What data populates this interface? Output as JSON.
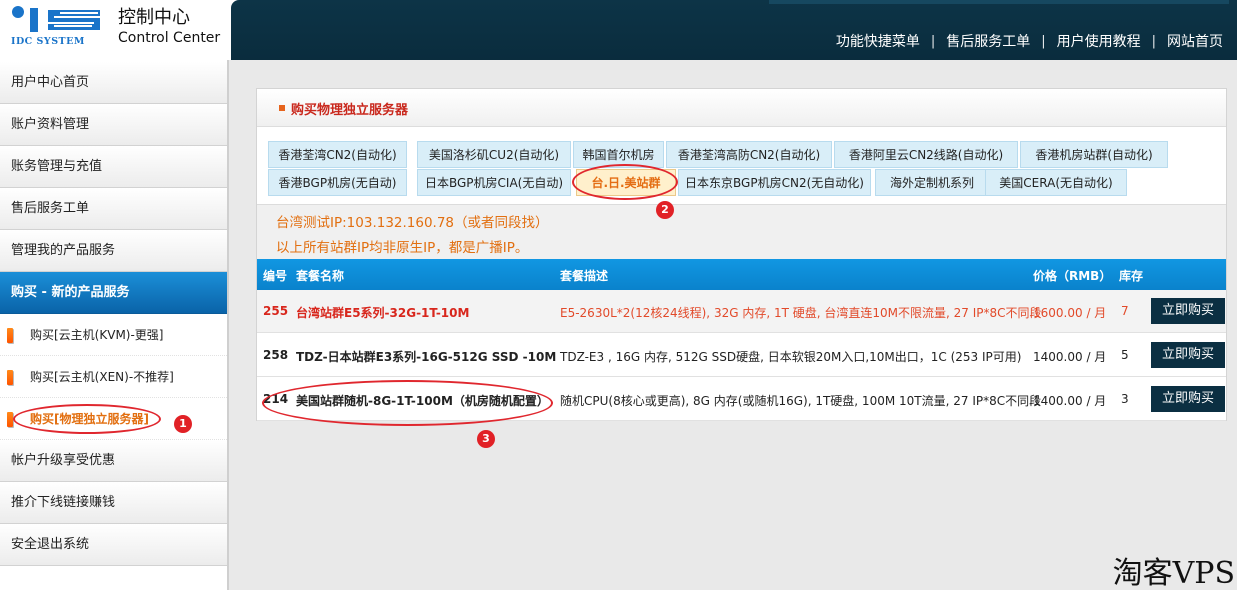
{
  "brand": {
    "logo_text": "IDC SYSTEM",
    "title_cn": "控制中心",
    "title_en": "Control Center",
    "colors": {
      "logo_blue": "#1a74c9",
      "topbar": "#0d3447"
    }
  },
  "topnav": [
    {
      "label": "功能快捷菜单"
    },
    {
      "label": "售后服务工单"
    },
    {
      "label": "用户使用教程"
    },
    {
      "label": "网站首页"
    }
  ],
  "topnav_separator": "|",
  "sidebar": {
    "items": [
      {
        "label": "用户中心首页"
      },
      {
        "label": "账户资料管理"
      },
      {
        "label": "账务管理与充值"
      },
      {
        "label": "售后服务工单"
      },
      {
        "label": "管理我的产品服务"
      },
      {
        "label": "购买 - 新的产品服务"
      },
      {
        "label": "购买[云主机(KVM)-更强]"
      },
      {
        "label": "购买[云主机(XEN)-不推荐]"
      },
      {
        "label": "购买[物理独立服务器]"
      },
      {
        "label": "帐户升级享受优惠"
      },
      {
        "label": "推介下线链接赚钱"
      },
      {
        "label": "安全退出系统"
      }
    ]
  },
  "panel": {
    "title": "购买物理独立服务器",
    "tabs": [
      {
        "label": "香港荃湾CN2(自动化)"
      },
      {
        "label": "美国洛杉矶CU2(自动化)"
      },
      {
        "label": "韩国首尔机房"
      },
      {
        "label": "香港荃湾高防CN2(自动化)"
      },
      {
        "label": "香港阿里云CN2线路(自动化)"
      },
      {
        "label": "香港机房站群(自动化)"
      },
      {
        "label": "香港BGP机房(无自动)"
      },
      {
        "label": "日本BGP机房CIA(无自动)"
      },
      {
        "label": "台.日.美站群"
      },
      {
        "label": "日本东京BGP机房CN2(无自动化)"
      },
      {
        "label": "海外定制机系列"
      },
      {
        "label": "美国CERA(无自动化)"
      }
    ],
    "active_tab": "台.日.美站群",
    "notices": [
      "台湾测试IP:103.132.160.78（或者同段找）",
      "以上所有站群IP均非原生IP，都是广播IP。"
    ]
  },
  "grid": {
    "columns": {
      "id": "编号",
      "name": "套餐名称",
      "desc": "套餐描述",
      "price": "价格（RMB）",
      "stock": "库存"
    },
    "rows": [
      {
        "id": "255",
        "name": "台湾站群E5系列-32G-1T-10M",
        "desc": "E5-2630L*2(12核24线程), 32G 内存, 1T 硬盘, 台湾直连10M不限流量, 27 IP*8C不同段",
        "price": "1600.00 / 月",
        "stock": "7",
        "button": "立即购买"
      },
      {
        "id": "258",
        "name": "TDZ-日本站群E3系列-16G-512G SSD -10M",
        "desc": "TDZ-E3 , 16G 内存, 512G SSD硬盘, 日本软银20M入口,10M出口，1C (253 IP可用)",
        "price": "1400.00 / 月",
        "stock": "5",
        "button": "立即购买"
      },
      {
        "id": "214",
        "name": "美国站群随机-8G-1T-100M（机房随机配置）",
        "desc": "随机CPU(8核心或更高), 8G 内存(或随机16G), 1T硬盘, 100M 10T流量, 27 IP*8C不同段",
        "price": "1400.00 / 月",
        "stock": "3",
        "button": "立即购买"
      }
    ]
  },
  "annotations": [
    "1",
    "2",
    "3"
  ],
  "watermark": "淘客VPS"
}
